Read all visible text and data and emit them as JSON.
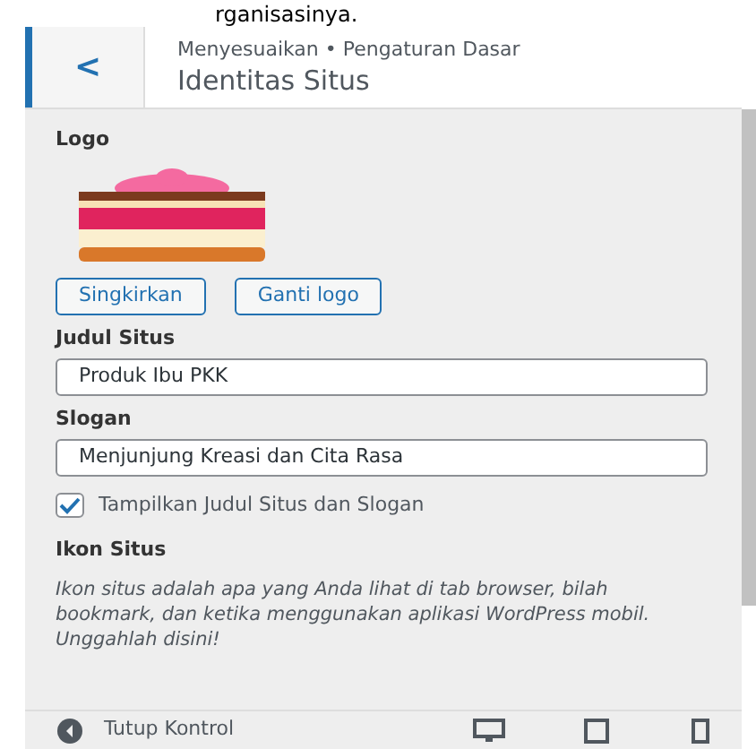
{
  "top_text": "rganisasinya.",
  "header": {
    "back_label": "<",
    "breadcrumb": "Menyesuaikan • Pengaturan Dasar",
    "title": "Identitas Situs"
  },
  "logo": {
    "label": "Logo",
    "buttons": [
      "Singkirkan",
      "Ganti logo"
    ]
  },
  "fields": [
    {
      "label": "Judul Situs",
      "value": "Produk Ibu PKK"
    },
    {
      "label": "Slogan",
      "value": "Menjunjung Kreasi dan Cita Rasa"
    }
  ],
  "display_checkbox": {
    "label": "Tampilkan Judul Situs dan Slogan",
    "checked": true
  },
  "site_icon": {
    "heading": "Ikon Situs",
    "description": "Ikon situs adalah apa yang Anda lihat di tab browser, bilah bookmark, dan ketika menggunakan aplikasi WordPress mobil. Unggahlah disini!"
  },
  "footer": {
    "label": "Tutup Kontrol"
  }
}
